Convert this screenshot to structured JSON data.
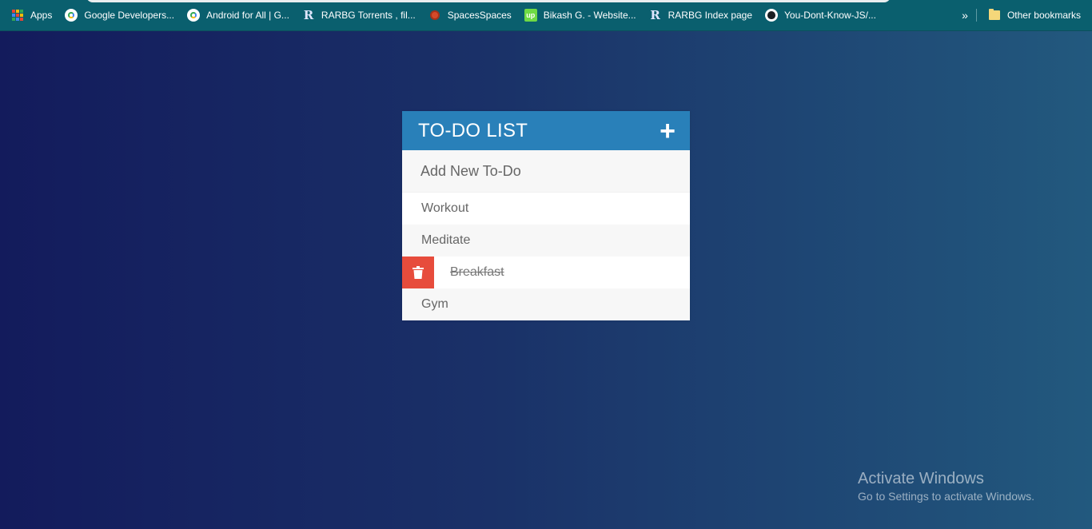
{
  "bookmarks": {
    "items": [
      {
        "label": "Apps",
        "icon": "apps-grid-icon"
      },
      {
        "label": "Google Developers...",
        "icon": "google-developers-icon"
      },
      {
        "label": "Android for All  |  G...",
        "icon": "google-developers-icon"
      },
      {
        "label": "RARBG Torrents , fil...",
        "icon": "rarbg-icon"
      },
      {
        "label": "SpacesSpaces",
        "icon": "spaces-icon"
      },
      {
        "label": "Bikash G. - Website...",
        "icon": "upwork-icon"
      },
      {
        "label": "RARBG Index page",
        "icon": "rarbg-icon"
      },
      {
        "label": "You-Dont-Know-JS/...",
        "icon": "github-icon"
      }
    ],
    "overflow_label": "»",
    "other_label": "Other bookmarks"
  },
  "todo": {
    "title": "TO-DO LIST",
    "add_symbol": "+",
    "input_placeholder": "Add New To-Do",
    "items": [
      {
        "text": "Workout",
        "completed": false
      },
      {
        "text": "Meditate",
        "completed": false
      },
      {
        "text": " Breakfast",
        "completed": true
      },
      {
        "text": "Gym",
        "completed": false
      }
    ]
  },
  "watermark": {
    "title": "Activate Windows",
    "subtitle": "Go to Settings to activate Windows."
  },
  "colors": {
    "header": "#2980b9",
    "delete": "#e74c3c",
    "bookmarks_bar": "#0a5f6e"
  }
}
